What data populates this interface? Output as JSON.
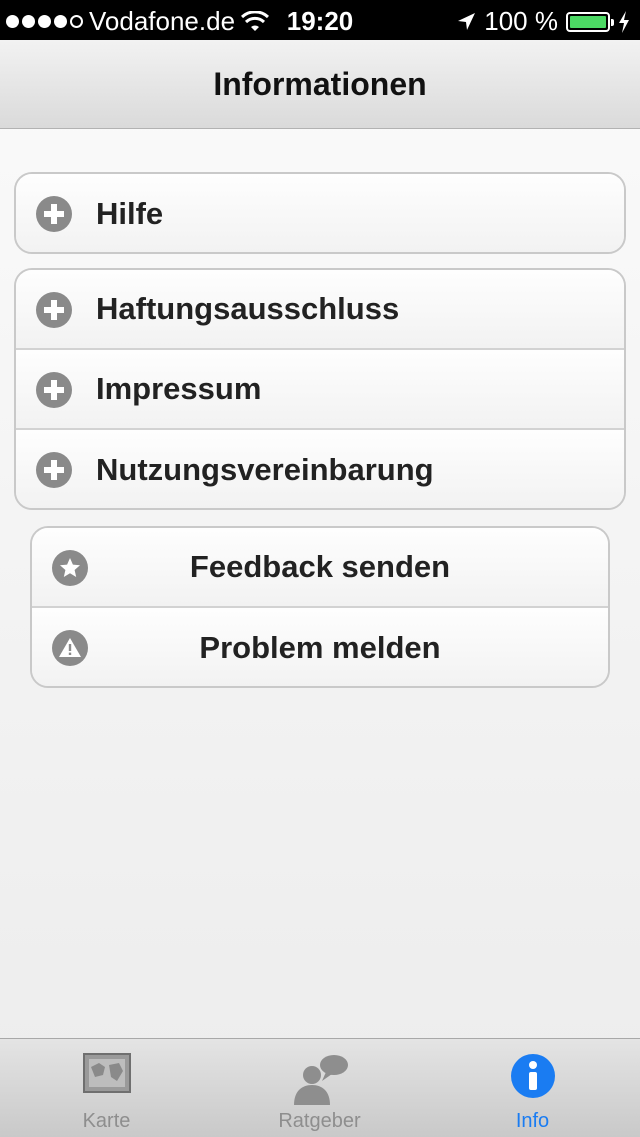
{
  "status": {
    "carrier": "Vodafone.de",
    "time": "19:20",
    "battery": "100 %",
    "battery_level": 1.0,
    "signal_bars": 4,
    "signal_total": 5
  },
  "nav": {
    "title": "Informationen"
  },
  "help_group": {
    "items": [
      {
        "label": "Hilfe",
        "icon": "plus-circle-icon"
      }
    ]
  },
  "info_group": {
    "items": [
      {
        "label": "Haftungsausschluss",
        "icon": "plus-circle-icon"
      },
      {
        "label": "Impressum",
        "icon": "plus-circle-icon"
      },
      {
        "label": "Nutzungsvereinbarung",
        "icon": "plus-circle-icon"
      }
    ]
  },
  "action_group": {
    "items": [
      {
        "label": "Feedback senden",
        "icon": "star-icon"
      },
      {
        "label": "Problem melden",
        "icon": "warning-icon"
      }
    ]
  },
  "tabbar": {
    "tabs": [
      {
        "label": "Karte",
        "icon": "map-icon",
        "active": false
      },
      {
        "label": "Ratgeber",
        "icon": "advisor-icon",
        "active": false
      },
      {
        "label": "Info",
        "icon": "info-icon",
        "active": true
      }
    ]
  },
  "colors": {
    "accent": "#1a7cf2",
    "battery": "#4cd964",
    "icon_gray": "#8a8a8a"
  }
}
